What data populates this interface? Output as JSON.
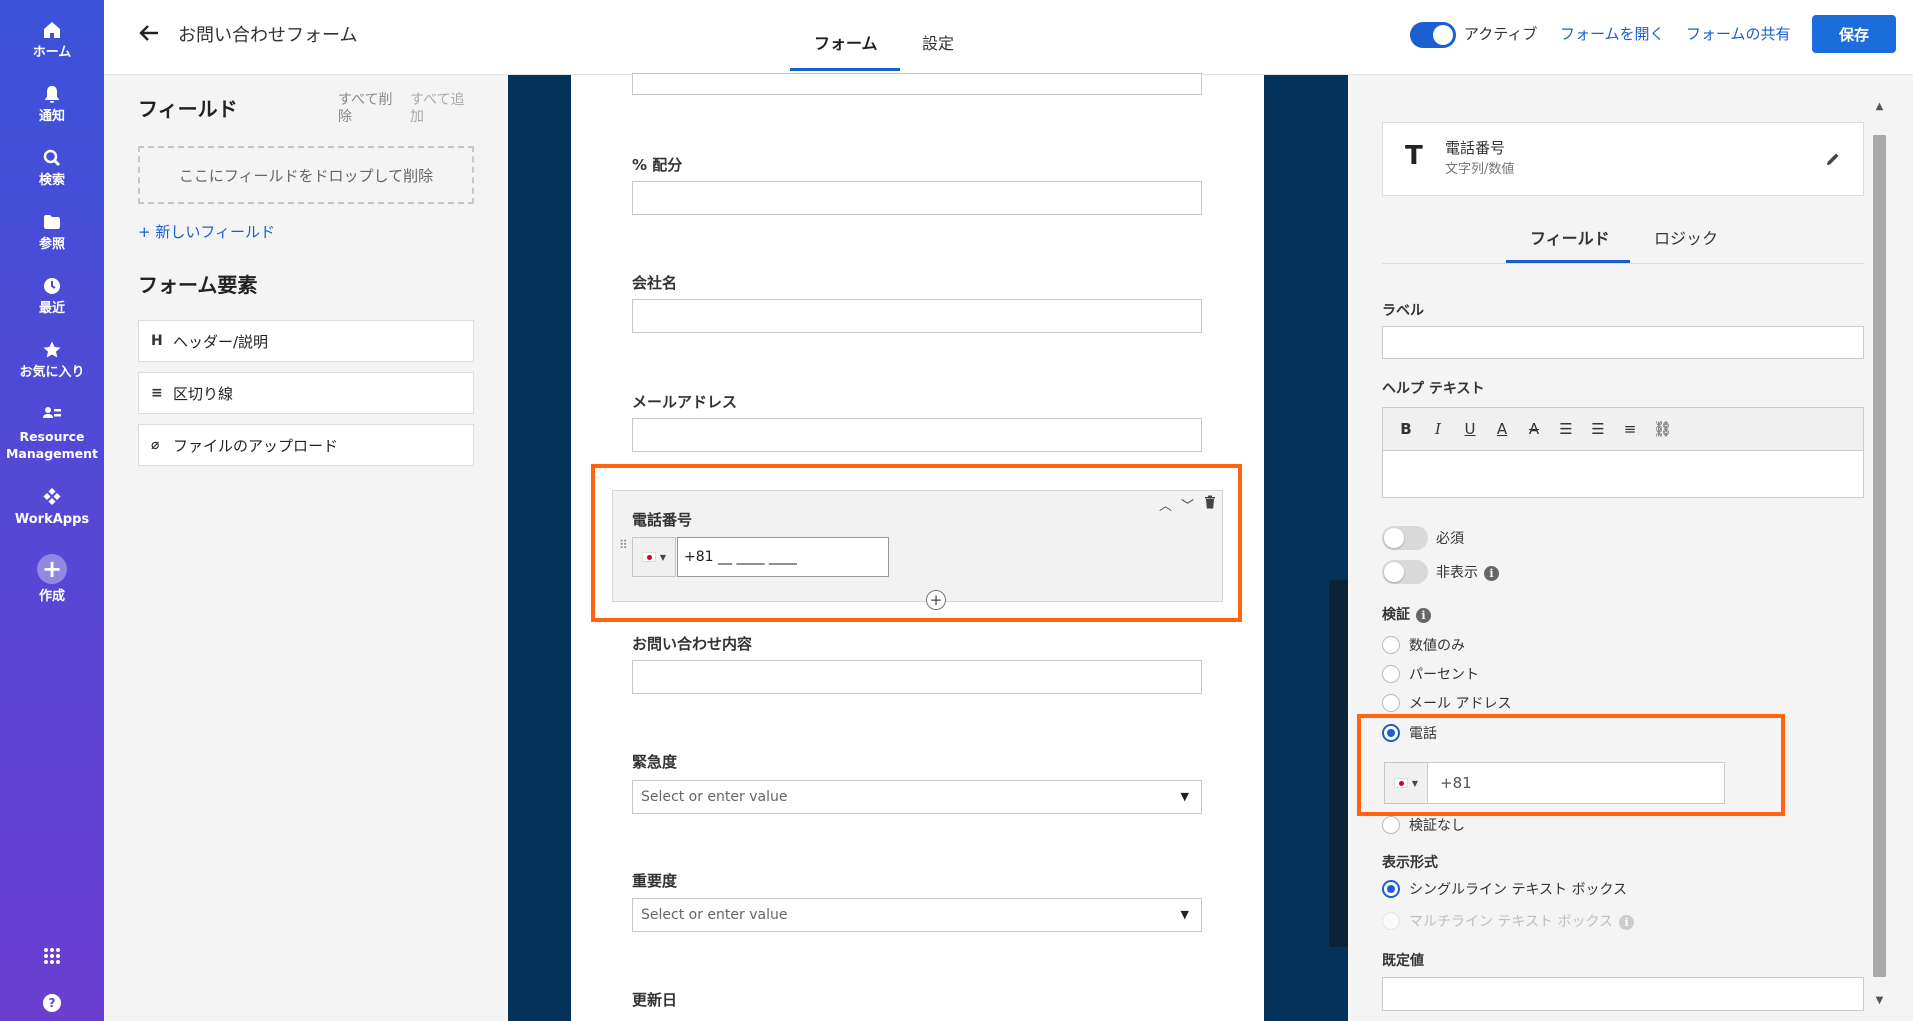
{
  "nav": {
    "items": [
      {
        "label": "ホーム",
        "icon": "home-icon"
      },
      {
        "label": "通知",
        "icon": "bell-icon"
      },
      {
        "label": "検索",
        "icon": "search-icon"
      },
      {
        "label": "参照",
        "icon": "folder-icon"
      },
      {
        "label": "最近",
        "icon": "clock-icon"
      },
      {
        "label": "お気に入り",
        "icon": "star-icon"
      },
      {
        "label": "Resource Management",
        "icon": "people-icon"
      },
      {
        "label": "WorkApps",
        "icon": "workapps-icon"
      },
      {
        "label": "作成",
        "icon": "plus-icon"
      }
    ]
  },
  "header": {
    "title": "お問い合わせフォーム",
    "tabs": [
      "フォーム",
      "設定"
    ],
    "active_label": "アクティブ",
    "open_form": "フォームを開く",
    "share_form": "フォームの共有",
    "save": "保存"
  },
  "left": {
    "fields_heading": "フィールド",
    "remove_all": "すべて削除",
    "add_all": "すべて追加",
    "drop_zone": "ここにフィールドをドロップして削除",
    "new_field": "+ 新しいフィールド",
    "elements_heading": "フォーム要素",
    "elements": [
      {
        "icon": "H",
        "label": "ヘッダー/説明"
      },
      {
        "icon": "≡",
        "label": "区切り線"
      },
      {
        "icon": "⌀",
        "label": "ファイルのアップロード"
      }
    ]
  },
  "form": {
    "fields": [
      {
        "label": "% 配分"
      },
      {
        "label": "会社名"
      },
      {
        "label": "メールアドレス"
      },
      {
        "label": "電話番号",
        "value": "+81 __ ____ ____"
      },
      {
        "label": "お問い合わせ内容"
      },
      {
        "label": "緊急度",
        "placeholder": "Select or enter value"
      },
      {
        "label": "重要度",
        "placeholder": "Select or enter value"
      },
      {
        "label": "更新日"
      }
    ]
  },
  "right": {
    "field_name": "電話番号",
    "field_type": "文字列/数値",
    "tabs": [
      "フィールド",
      "ロジック"
    ],
    "label_label": "ラベル",
    "help_label": "ヘルプ テキスト",
    "required": "必須",
    "hidden": "非表示",
    "validation_label": "検証",
    "validation_options": [
      "数値のみ",
      "パーセント",
      "メール アドレス",
      "電話",
      "検証なし"
    ],
    "phone_code": "+81",
    "display_label": "表示形式",
    "display_options": [
      "シングルライン テキスト ボックス",
      "マルチライン テキスト ボックス"
    ],
    "default_label": "既定値"
  },
  "colors": {
    "accent": "#1a5fd0",
    "highlight": "#ff6411",
    "canvas": "#05325a"
  }
}
